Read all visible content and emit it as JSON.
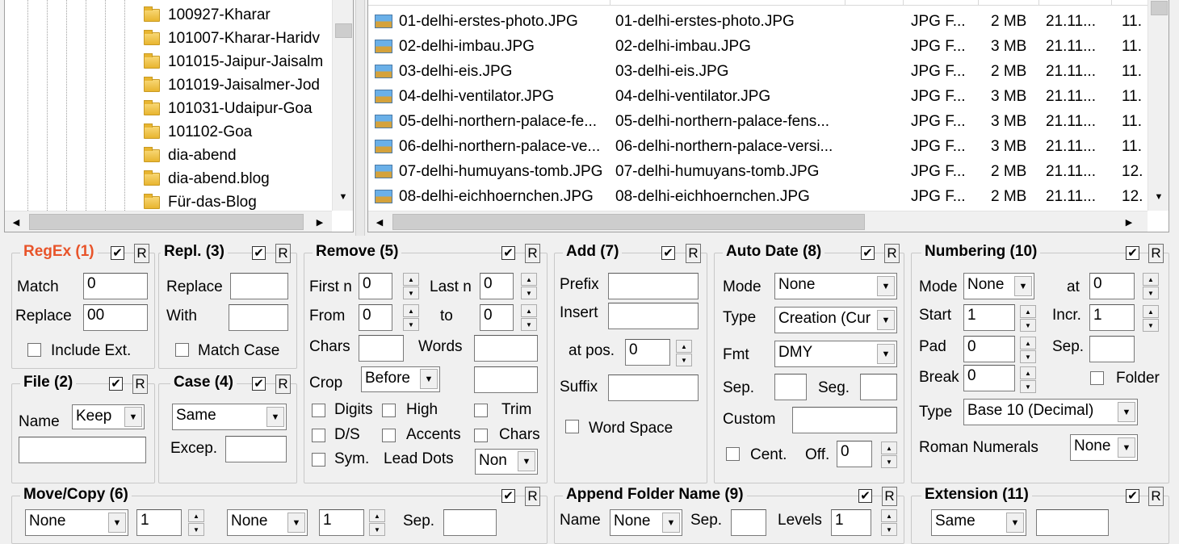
{
  "tree": {
    "items": [
      "100927-Kharar",
      "101007-Kharar-Haridv",
      "101015-Jaipur-Jaisalm",
      "101019-Jaisalmer-Jod",
      "101031-Udaipur-Goa",
      "101102-Goa",
      "dia-abend",
      "dia-abend.blog",
      "Für-das-Blog"
    ]
  },
  "files": {
    "rows": [
      {
        "name": "01-delhi-erstes-photo.JPG",
        "newname": "01-delhi-erstes-photo.JPG",
        "type": "JPG F...",
        "size": "2 MB",
        "mod": "21.11...",
        "cre": "11."
      },
      {
        "name": "02-delhi-imbau.JPG",
        "newname": "02-delhi-imbau.JPG",
        "type": "JPG F...",
        "size": "3 MB",
        "mod": "21.11...",
        "cre": "11."
      },
      {
        "name": "03-delhi-eis.JPG",
        "newname": "03-delhi-eis.JPG",
        "type": "JPG F...",
        "size": "2 MB",
        "mod": "21.11...",
        "cre": "11."
      },
      {
        "name": "04-delhi-ventilator.JPG",
        "newname": "04-delhi-ventilator.JPG",
        "type": "JPG F...",
        "size": "3 MB",
        "mod": "21.11...",
        "cre": "11."
      },
      {
        "name": "05-delhi-northern-palace-fe...",
        "newname": "05-delhi-northern-palace-fens...",
        "type": "JPG F...",
        "size": "3 MB",
        "mod": "21.11...",
        "cre": "11."
      },
      {
        "name": "06-delhi-northern-palace-ve...",
        "newname": "06-delhi-northern-palace-versi...",
        "type": "JPG F...",
        "size": "3 MB",
        "mod": "21.11...",
        "cre": "11."
      },
      {
        "name": "07-delhi-humuyans-tomb.JPG",
        "newname": "07-delhi-humuyans-tomb.JPG",
        "type": "JPG F...",
        "size": "2 MB",
        "mod": "21.11...",
        "cre": "12."
      },
      {
        "name": "08-delhi-eichhoernchen.JPG",
        "newname": "08-delhi-eichhoernchen.JPG",
        "type": "JPG F...",
        "size": "2 MB",
        "mod": "21.11...",
        "cre": "12."
      }
    ]
  },
  "regex": {
    "title": "RegEx (1)",
    "match_label": "Match",
    "match_value": "0",
    "replace_label": "Replace",
    "replace_value": "00",
    "include_ext": "Include Ext.",
    "r": "R"
  },
  "repl": {
    "title": "Repl. (3)",
    "replace_label": "Replace",
    "with_label": "With",
    "match_case": "Match Case",
    "r": "R"
  },
  "remove": {
    "title": "Remove (5)",
    "first_n": "First n",
    "first_n_value": "0",
    "last_n": "Last n",
    "last_n_value": "0",
    "from": "From",
    "from_value": "0",
    "to": "to",
    "to_value": "0",
    "chars": "Chars",
    "words": "Words",
    "crop": "Crop",
    "crop_value": "Before",
    "digits": "Digits",
    "high": "High",
    "trim": "Trim",
    "ds": "D/S",
    "accents": "Accents",
    "chars2": "Chars",
    "sym": "Sym.",
    "lead_dots": "Lead Dots",
    "lead_dots_value": "Non",
    "r": "R"
  },
  "add": {
    "title": "Add (7)",
    "prefix": "Prefix",
    "insert": "Insert",
    "at_pos": "at pos.",
    "at_pos_value": "0",
    "suffix": "Suffix",
    "word_space": "Word Space",
    "r": "R"
  },
  "autodate": {
    "title": "Auto Date (8)",
    "mode": "Mode",
    "mode_value": "None",
    "type": "Type",
    "type_value": "Creation (Cur",
    "fmt": "Fmt",
    "fmt_value": "DMY",
    "sep": "Sep.",
    "seg": "Seg.",
    "custom": "Custom",
    "cent": "Cent.",
    "off": "Off.",
    "off_value": "0",
    "r": "R"
  },
  "numbering": {
    "title": "Numbering (10)",
    "mode": "Mode",
    "mode_value": "None",
    "at": "at",
    "at_value": "0",
    "start": "Start",
    "start_value": "1",
    "incr": "Incr.",
    "incr_value": "1",
    "pad": "Pad",
    "pad_value": "0",
    "sep": "Sep.",
    "break": "Break",
    "break_value": "0",
    "folder": "Folder",
    "type": "Type",
    "type_value": "Base 10 (Decimal)",
    "roman": "Roman Numerals",
    "roman_value": "None",
    "r": "R"
  },
  "file": {
    "title": "File (2)",
    "name": "Name",
    "name_value": "Keep",
    "r": "R"
  },
  "case": {
    "title": "Case (4)",
    "value": "Same",
    "excep": "Excep.",
    "r": "R"
  },
  "movecopy": {
    "title": "Move/Copy (6)",
    "sel1": "None",
    "num1": "1",
    "sel2": "None",
    "num2": "1",
    "sep": "Sep.",
    "r": "R"
  },
  "append": {
    "title": "Append Folder Name (9)",
    "name": "Name",
    "name_value": "None",
    "sep": "Sep.",
    "levels": "Levels",
    "levels_value": "1",
    "r": "R"
  },
  "extension": {
    "title": "Extension (11)",
    "value": "Same",
    "r": "R"
  }
}
